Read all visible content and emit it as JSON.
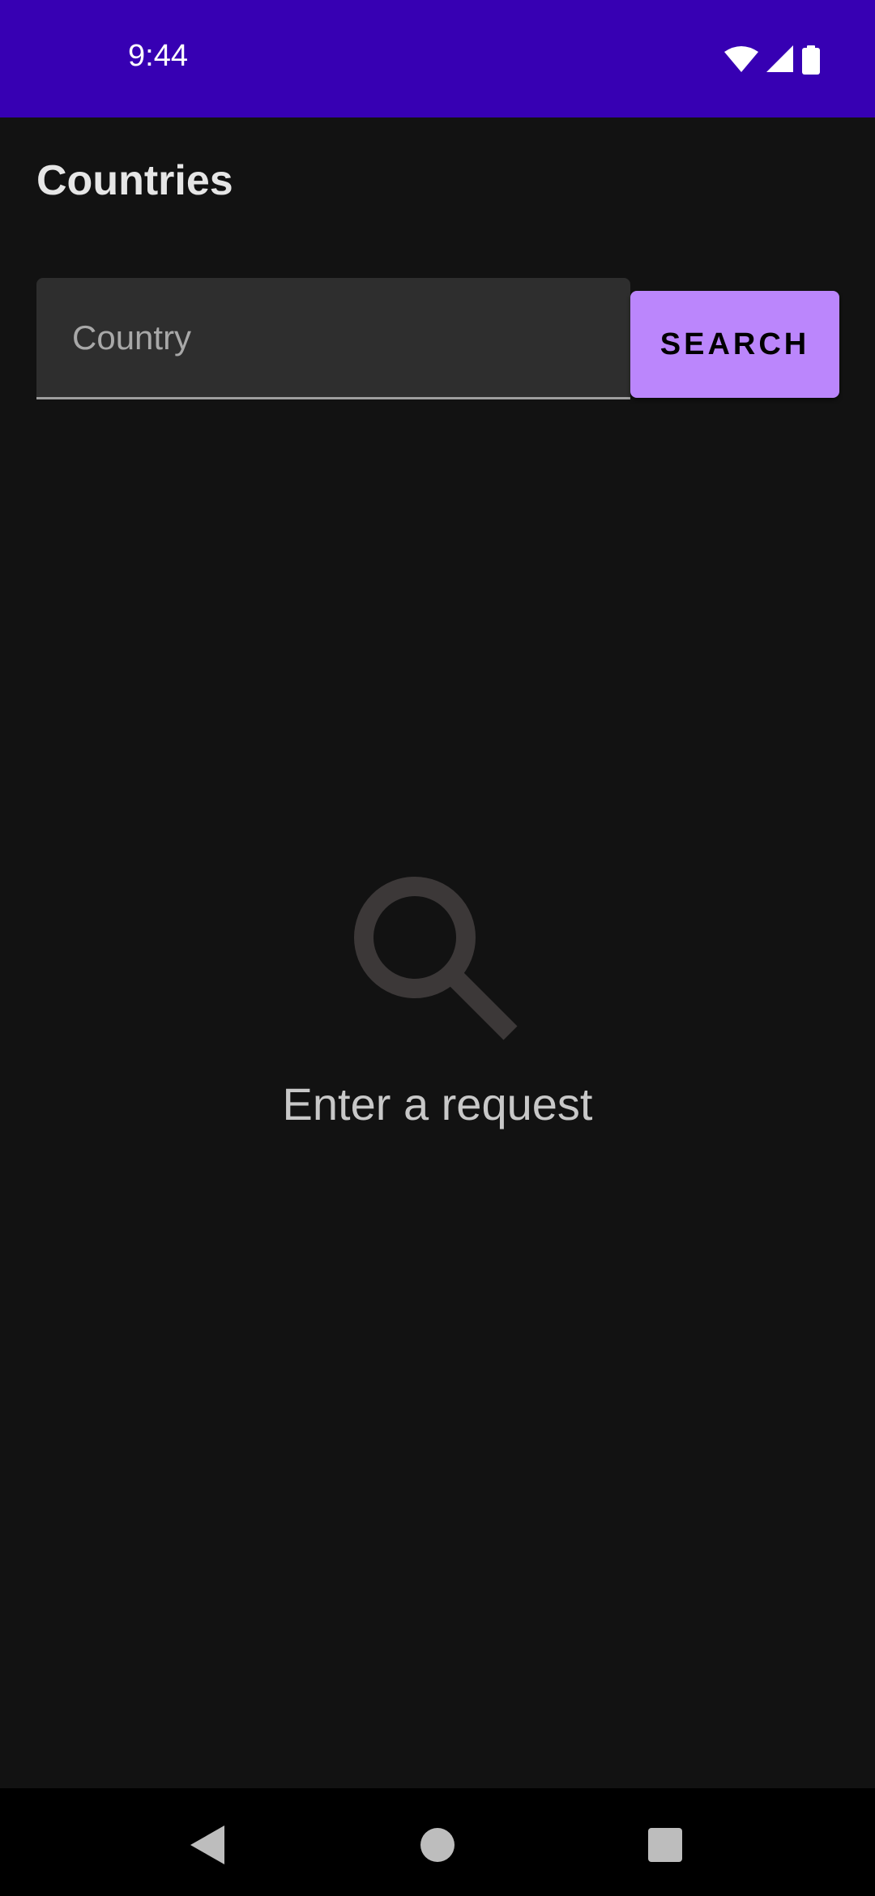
{
  "status_bar": {
    "time": "9:44",
    "background_color": "#3700b3",
    "icons": [
      "wifi-icon",
      "signal-icon",
      "battery-icon"
    ]
  },
  "screen": {
    "title": "Countries"
  },
  "search": {
    "placeholder": "Country",
    "value": "",
    "button_label": "SEARCH",
    "accent_color": "#bb86fc"
  },
  "empty_state": {
    "icon": "search-icon",
    "message": "Enter a request"
  },
  "nav_bar": {
    "buttons": [
      "back-icon",
      "home-icon",
      "recents-icon"
    ]
  }
}
